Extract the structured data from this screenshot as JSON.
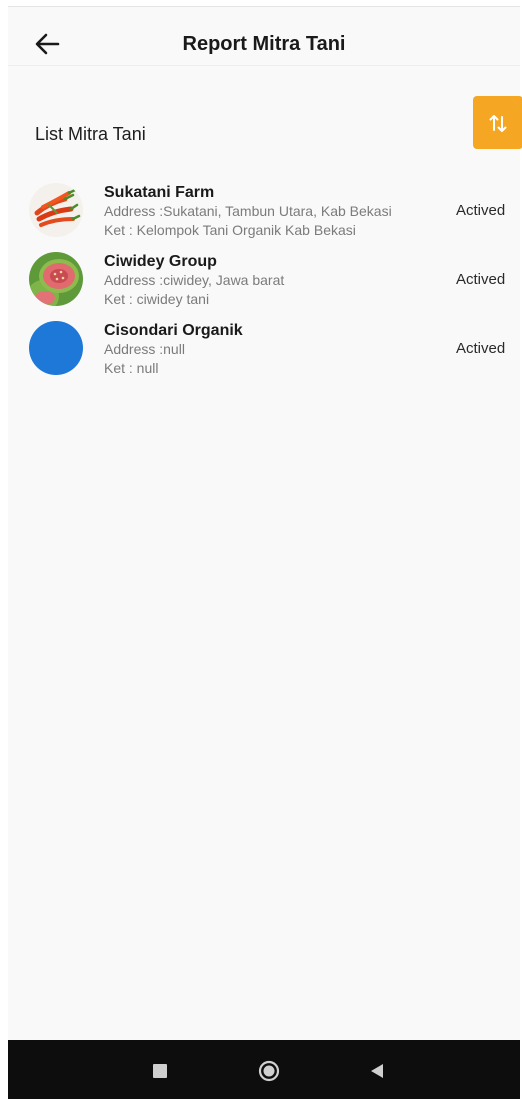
{
  "appbar": {
    "title": "Report Mitra Tani",
    "back_icon": "arrow-left-icon"
  },
  "section": {
    "title": "List Mitra Tani",
    "sort_icon": "sort-arrows-icon",
    "sort_color": "#f5a623"
  },
  "items": [
    {
      "name": "Sukatani Farm",
      "address": "Address :Sukatani, Tambun Utara, Kab Bekasi",
      "ket": "Ket : Kelompok Tani Organik  Kab Bekasi",
      "status": "Actived",
      "avatar": "chili-peppers-photo"
    },
    {
      "name": "Ciwidey Group",
      "address": "Address :ciwidey, Jawa barat",
      "ket": "Ket : ciwidey tani",
      "status": "Actived",
      "avatar": "guava-photo"
    },
    {
      "name": "Cisondari Organik",
      "address": "Address :null",
      "ket": "Ket : null",
      "status": "Actived",
      "avatar": "blue-placeholder",
      "avatar_color": "#1e78d8"
    }
  ],
  "navbar": {
    "recents_icon": "square-icon",
    "home_icon": "circle-icon",
    "back_icon": "triangle-back-icon"
  }
}
